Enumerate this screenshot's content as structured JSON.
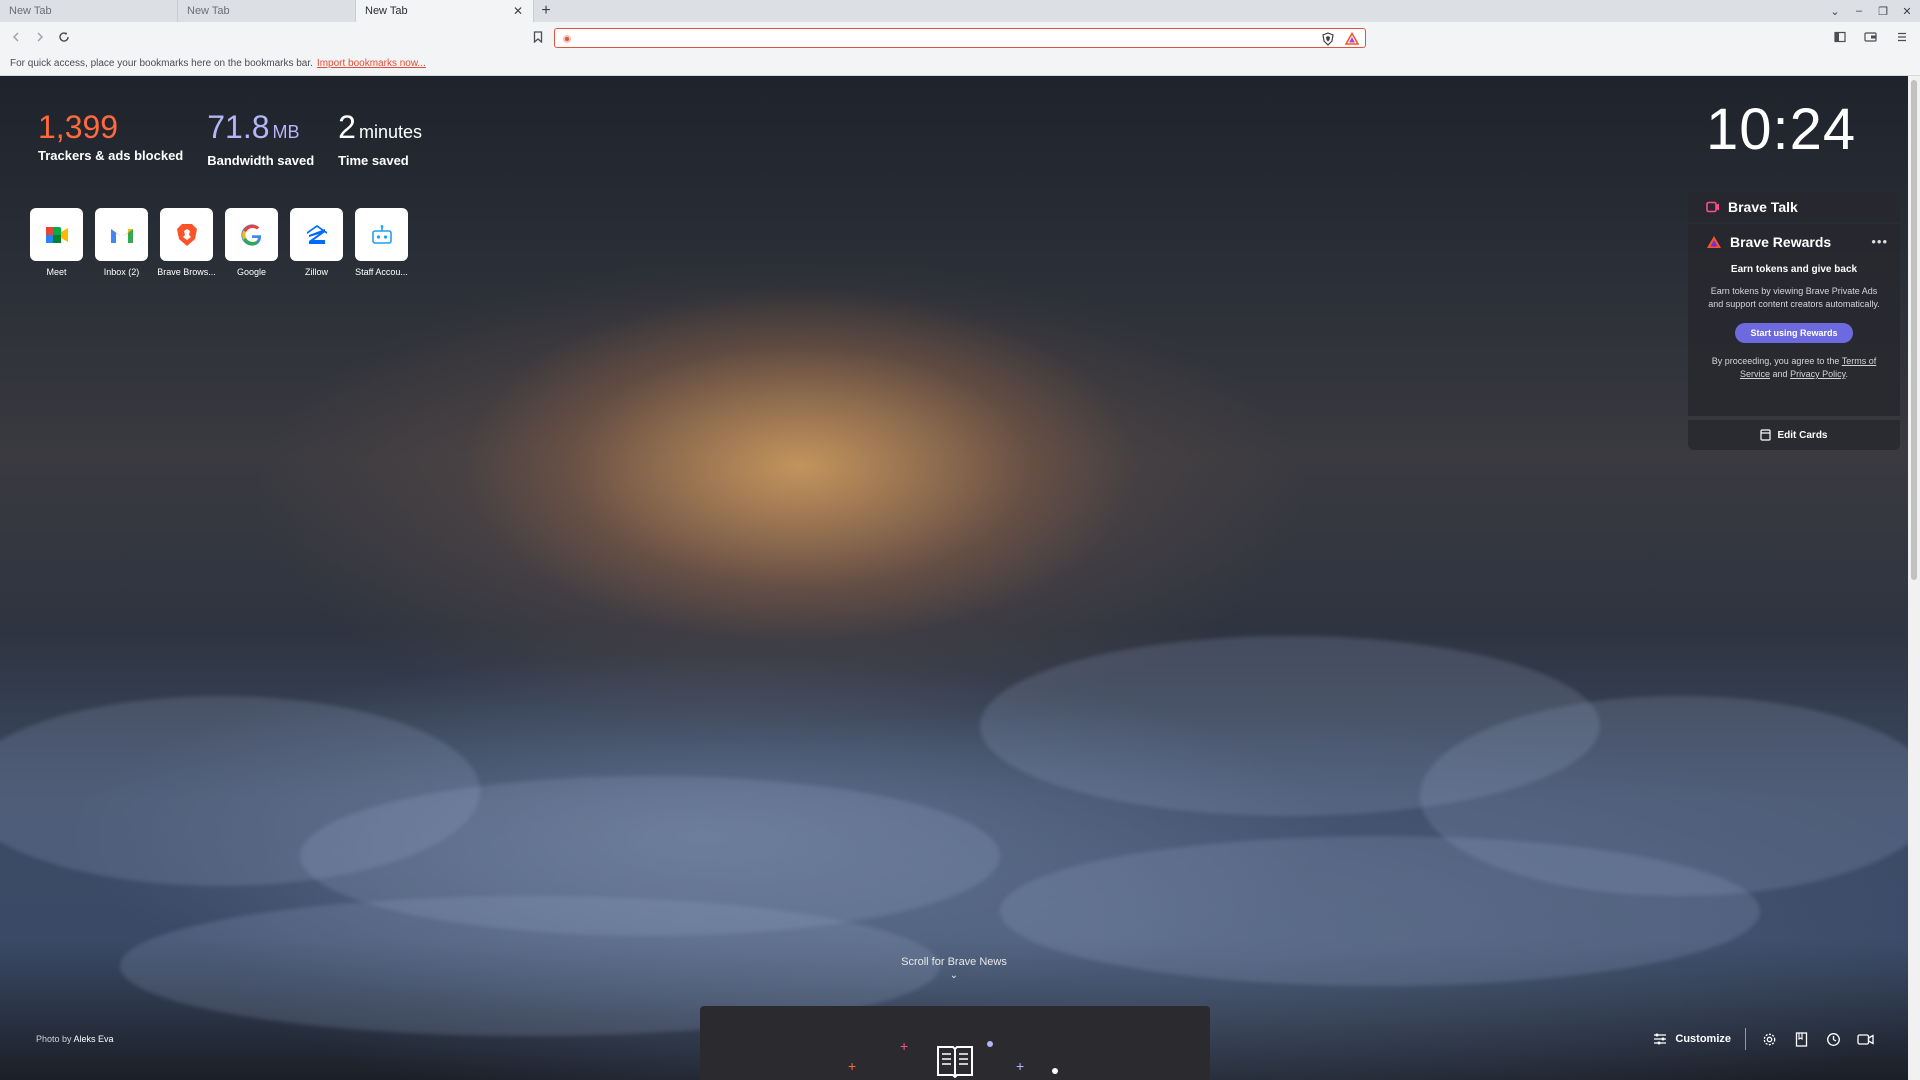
{
  "tabs": [
    {
      "title": "New Tab"
    },
    {
      "title": "New Tab"
    },
    {
      "title": "New Tab"
    }
  ],
  "toolbar": {
    "address_value": "",
    "address_placeholder": ""
  },
  "bookmarks_bar": {
    "message": "For quick access, place your bookmarks here on the bookmarks bar.",
    "import_link": "Import bookmarks now..."
  },
  "stats": {
    "trackers_value": "1,399",
    "trackers_label": "Trackers & ads blocked",
    "bandwidth_value": "71.8",
    "bandwidth_unit": "MB",
    "bandwidth_label": "Bandwidth saved",
    "time_value": "2",
    "time_unit": "minutes",
    "time_label": "Time saved"
  },
  "top_sites": [
    {
      "name": "Meet",
      "icon": "google-meet-icon"
    },
    {
      "name": "Inbox (2)",
      "icon": "gmail-icon"
    },
    {
      "name": "Brave Brows...",
      "icon": "brave-lion-icon"
    },
    {
      "name": "Google",
      "icon": "google-g-icon"
    },
    {
      "name": "Zillow",
      "icon": "zillow-icon"
    },
    {
      "name": "Staff Accou...",
      "icon": "robot-icon"
    }
  ],
  "clock": "10:24",
  "brave_talk": {
    "title": "Brave Talk"
  },
  "brave_rewards": {
    "title": "Brave Rewards",
    "more": "•••",
    "subtitle": "Earn tokens and give back",
    "description": "Earn tokens by viewing Brave Private Ads and support content creators automatically.",
    "cta": "Start using Rewards",
    "terms_prefix": "By proceeding, you agree to the",
    "terms_link": "Terms of Service",
    "terms_and": "and",
    "privacy_link": "Privacy Policy",
    "terms_suffix": "."
  },
  "edit_cards": "Edit Cards",
  "scroll_news": "Scroll for Brave News",
  "photo_credit": {
    "prefix": "Photo by",
    "author": "Aleks Eva"
  },
  "bottom": {
    "customize": "Customize"
  },
  "colors": {
    "trackers": "#ff6a3d",
    "bandwidth": "#b3b6f7",
    "rewards_button": "#6d6ae0",
    "brave_orange": "#fb542b"
  }
}
